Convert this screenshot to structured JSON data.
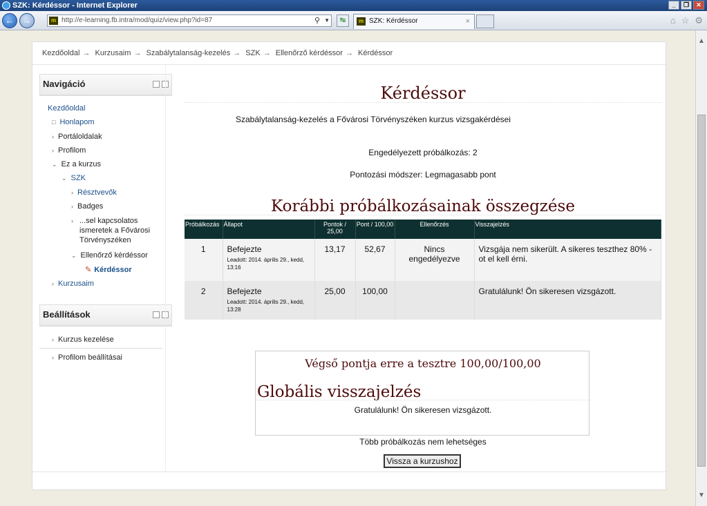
{
  "window": {
    "title": "SZK: Kérdéssor - Internet Explorer"
  },
  "browser": {
    "url": "http://e-learning.fb.intra/mod/quiz/view.php?id=87",
    "tab_title": "SZK: Kérdéssor",
    "search_glyph": "⚲",
    "dropdown_glyph": "▼"
  },
  "breadcrumb": [
    "Kezdőoldal",
    "Kurzusaim",
    "Szabálytalanság-kezelés",
    "SZK",
    "Ellenőrző kérdéssor",
    "Kérdéssor"
  ],
  "navigation": {
    "title": "Navigáció",
    "items": [
      {
        "label": "Kezdőoldal"
      },
      {
        "label": "Honlapom"
      },
      {
        "label": "Portáloldalak"
      },
      {
        "label": "Profilom"
      },
      {
        "label": "Ez a kurzus"
      },
      {
        "label": "SZK"
      },
      {
        "label": "Résztvevők"
      },
      {
        "label": "Badges"
      },
      {
        "label": "...sel kapcsolatos ismeretek a Fővárosi Törvényszéken"
      },
      {
        "label": "Ellenőrző kérdéssor"
      },
      {
        "label": "Kérdéssor"
      },
      {
        "label": "Kurzusaim"
      }
    ]
  },
  "settings": {
    "title": "Beállítások",
    "items": [
      {
        "label": "Kurzus kezelése"
      },
      {
        "label": "Profilom beállításai"
      }
    ]
  },
  "main": {
    "title": "Kérdéssor",
    "intro": "Szabálytalanság-kezelés a Fővárosi Törvényszéken kurzus vizsgakérdései",
    "attempts_allowed": "Engedélyezett próbálkozás: 2",
    "grading_method": "Pontozási módszer: Legmagasabb pont",
    "summary_heading": "Korábbi próbálkozásainak összegzése",
    "table": {
      "headers": [
        "Próbálkozás",
        "Állapot",
        "Pontok / 25,00",
        "Pont / 100,00",
        "Ellenőrzés",
        "Visszajelzés"
      ],
      "rows": [
        {
          "attempt": "1",
          "status": "Befejezte",
          "submitted": "Leadott: 2014. április 29., kedd, 13:16",
          "points": "13,17",
          "grade": "52,67",
          "review": "Nincs engedélyezve",
          "feedback": "Vizsgája nem sikerült. A sikeres teszthez 80% -ot el kell érni."
        },
        {
          "attempt": "2",
          "status": "Befejezte",
          "submitted": "Leadott: 2014. április 29., kedd, 13:28",
          "points": "25,00",
          "grade": "100,00",
          "review": "",
          "feedback": "Gratulálunk! Ön sikeresen vizsgázott."
        }
      ]
    },
    "final_grade": "Végső pontja erre a tesztre 100,00/100,00",
    "global_feedback_heading": "Globális visszajelzés",
    "global_feedback_text": "Gratulálunk! Ön sikeresen vizsgázott.",
    "no_more_attempts": "Több próbálkozás nem lehetséges",
    "back_button": "Vissza a kurzushoz"
  }
}
